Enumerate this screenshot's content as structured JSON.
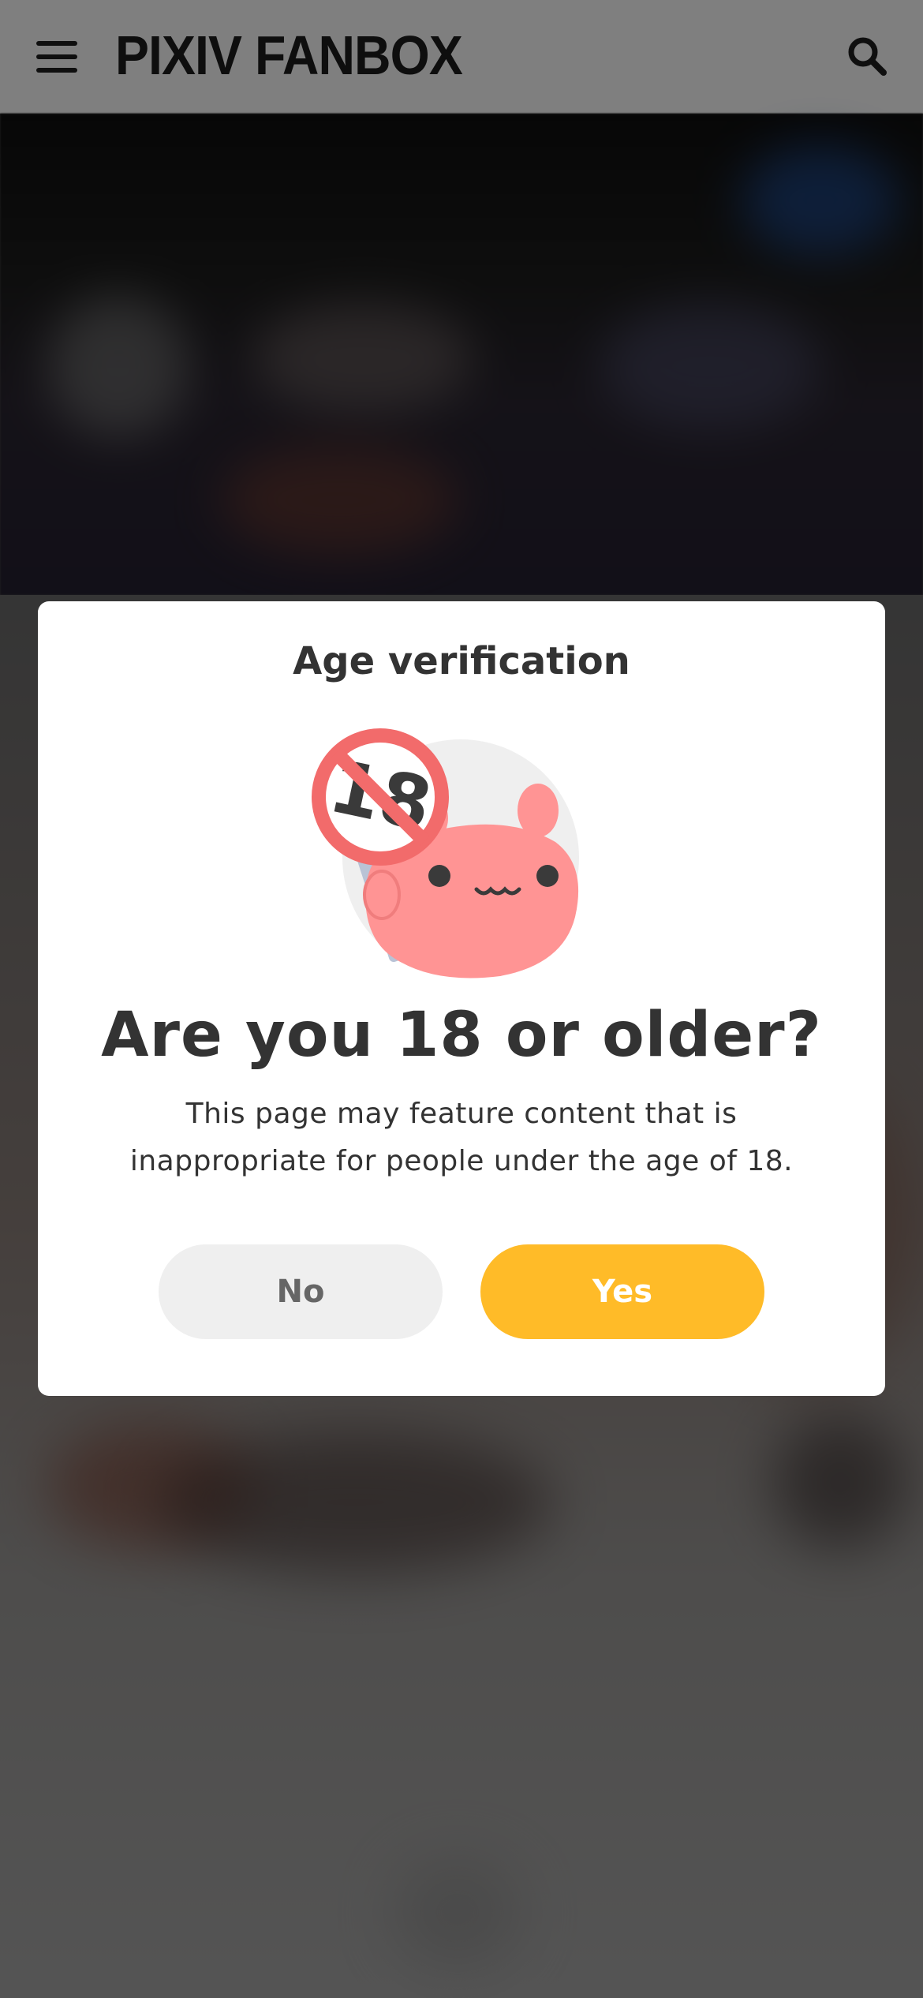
{
  "header": {
    "logo_text": "PIXIV FANBOX",
    "menu_icon": "hamburger-menu-icon",
    "search_icon": "search-icon"
  },
  "age_modal": {
    "title": "Age verification",
    "illustration": "restricted-18-mascot-illustration",
    "sign_text": "18",
    "question": "Are you 18 or older?",
    "description": "This page may feature content that is inappropriate for people under the age of 18.",
    "no_label": "No",
    "yes_label": "Yes"
  },
  "colors": {
    "yes_button": "#ffbb28",
    "no_button": "#efefef",
    "mascot_pink": "#ff9494",
    "prohibited_red": "#f26b6b",
    "text_dark": "#333333"
  }
}
